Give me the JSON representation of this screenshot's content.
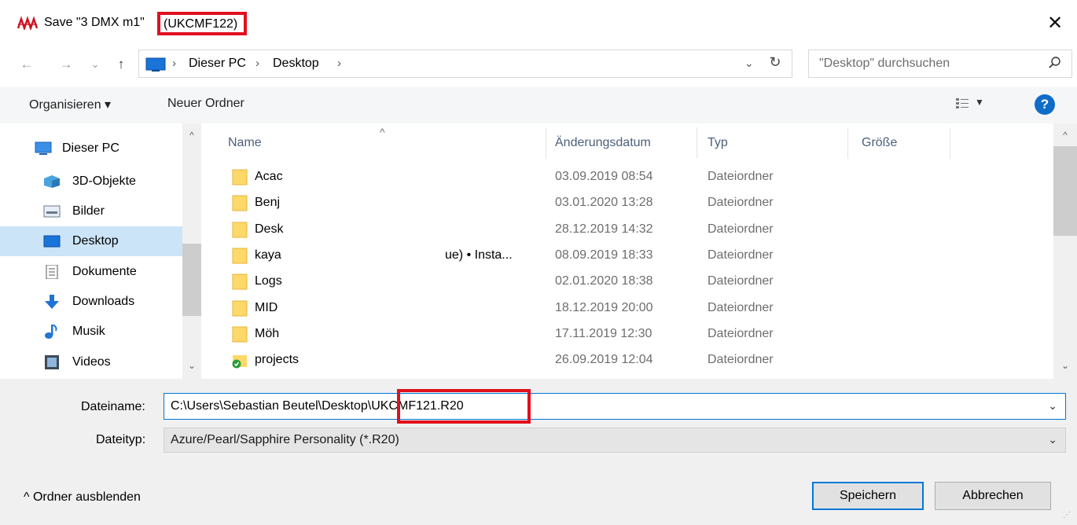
{
  "window": {
    "title_prefix": "Save \"3 DMX m1\"",
    "title_highlight": "(UKCMF122)",
    "close_glyph": "✕",
    "app_icon": "app-logo-icon"
  },
  "nav": {
    "back_glyph": "←",
    "forward_glyph": "→",
    "recent_glyph": "⌄",
    "up_glyph": "↑"
  },
  "address": {
    "crumbs": [
      "Dieser PC",
      "Desktop"
    ],
    "sep": "›",
    "dropdown_glyph": "⌄",
    "refresh_glyph": "↻"
  },
  "search": {
    "placeholder": "\"Desktop\" durchsuchen"
  },
  "toolbar": {
    "organize": "Organisieren ▾",
    "new_folder": "Neuer Ordner",
    "view_dropdown": "▼",
    "help": "?"
  },
  "sidebar": {
    "items": [
      {
        "label": "Dieser PC",
        "icon": "pc-icon"
      },
      {
        "label": "3D-Objekte",
        "icon": "3d-objects-icon"
      },
      {
        "label": "Bilder",
        "icon": "pictures-icon"
      },
      {
        "label": "Desktop",
        "icon": "desktop-icon",
        "selected": true
      },
      {
        "label": "Dokumente",
        "icon": "documents-icon"
      },
      {
        "label": "Downloads",
        "icon": "downloads-icon"
      },
      {
        "label": "Musik",
        "icon": "music-icon"
      },
      {
        "label": "Videos",
        "icon": "videos-icon"
      }
    ],
    "scroll_up": "^",
    "scroll_down": "⌄"
  },
  "files": {
    "columns": [
      "Name",
      "Änderungsdatum",
      "Typ",
      "Größe"
    ],
    "sort_glyph": "^",
    "rows": [
      {
        "name": "Acac",
        "extra": "",
        "date": "03.09.2019 08:54",
        "type": "Dateiordner"
      },
      {
        "name": "Benj",
        "extra": "",
        "date": "03.01.2020 13:28",
        "type": "Dateiordner"
      },
      {
        "name": "Desk",
        "extra": "",
        "date": "28.12.2019 14:32",
        "type": "Dateiordner"
      },
      {
        "name": "kaya",
        "extra": "ue) • Insta...",
        "date": "08.09.2019 18:33",
        "type": "Dateiordner"
      },
      {
        "name": "Logs",
        "extra": "",
        "date": "02.01.2020 18:38",
        "type": "Dateiordner"
      },
      {
        "name": "MID",
        "extra": "",
        "date": "18.12.2019 20:00",
        "type": "Dateiordner"
      },
      {
        "name": "Möh",
        "extra": "",
        "date": "17.11.2019 12:30",
        "type": "Dateiordner"
      },
      {
        "name": "projects",
        "extra": "",
        "date": "26.09.2019 12:04",
        "type": "Dateiordner",
        "synced": true
      }
    ],
    "scroll_up": "^",
    "scroll_down": "⌄"
  },
  "form": {
    "filename_label": "Dateiname:",
    "filename_value": "C:\\Users\\Sebastian Beutel\\Desktop\\UKCMF121.R20",
    "filetype_label": "Dateityp:",
    "filetype_value": "Azure/Pearl/Sapphire Personality (*.R20)",
    "dropdown_glyph": "⌄"
  },
  "footer": {
    "hide_folders": "^  Ordner ausblenden",
    "save": "Speichern",
    "cancel": "Abbrechen",
    "grip": "⋰"
  },
  "colors": {
    "highlight": "#e0101e",
    "accent": "#0078d7",
    "selection": "#cce4f7",
    "folder": "#ffd86a"
  }
}
